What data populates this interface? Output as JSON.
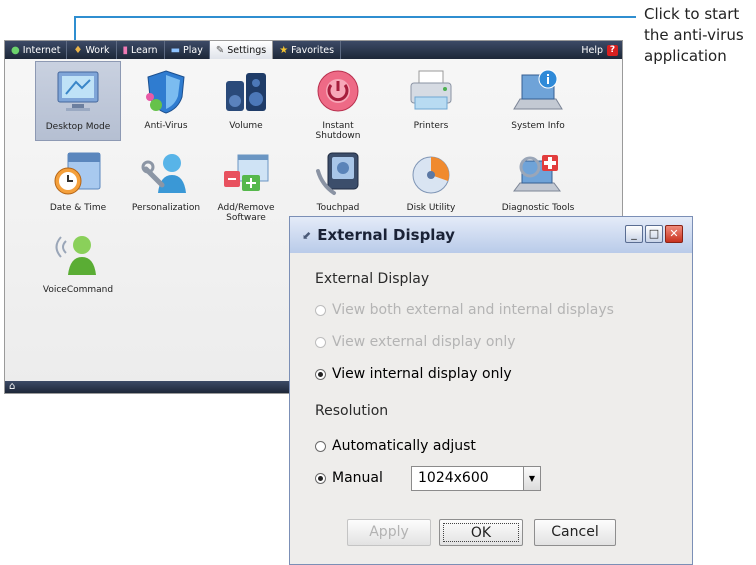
{
  "callout": {
    "lines": [
      "Click to start",
      "the anti-virus",
      "application"
    ],
    "color": "#2f8ed0"
  },
  "tabs": [
    {
      "label": "Internet",
      "icon": "globe-icon"
    },
    {
      "label": "Work",
      "icon": "work-icon"
    },
    {
      "label": "Learn",
      "icon": "learn-icon"
    },
    {
      "label": "Play",
      "icon": "play-icon"
    },
    {
      "label": "Settings",
      "icon": "wrench-icon",
      "active": true
    },
    {
      "label": "Favorites",
      "icon": "star-icon"
    }
  ],
  "help_label": "Help",
  "apps": [
    {
      "label": "Desktop Mode",
      "icon": "desktop-mode-icon",
      "selected": true
    },
    {
      "label": "Anti-Virus",
      "icon": "anti-virus-icon"
    },
    {
      "label": "Volume",
      "icon": "volume-icon"
    },
    {
      "label": "Instant\nShutdown",
      "icon": "shutdown-icon"
    },
    {
      "label": "Printers",
      "icon": "printer-icon"
    },
    {
      "label": "System Info",
      "icon": "system-info-icon"
    },
    {
      "label": "Date & Time",
      "icon": "calendar-clock-icon"
    },
    {
      "label": "Personalization",
      "icon": "personalization-icon"
    },
    {
      "label": "Add/Remove\nSoftware",
      "icon": "add-remove-software-icon"
    },
    {
      "label": "Touchpad",
      "icon": "touchpad-icon"
    },
    {
      "label": "Disk Utility",
      "icon": "disk-utility-icon"
    },
    {
      "label": "Diagnostic Tools",
      "icon": "diagnostic-tools-icon"
    },
    {
      "label": "VoiceCommand",
      "icon": "voice-command-icon"
    }
  ],
  "dialog": {
    "title": "External Display",
    "section_display": "External Display",
    "options_display": [
      {
        "label": "View both external and internal displays",
        "checked": false,
        "disabled": true
      },
      {
        "label": "View external display only",
        "checked": false,
        "disabled": true
      },
      {
        "label": "View internal display only",
        "checked": true,
        "disabled": false
      }
    ],
    "section_resolution": "Resolution",
    "options_resolution": [
      {
        "label": "Automatically adjust",
        "checked": false
      },
      {
        "label": "Manual",
        "checked": true
      }
    ],
    "resolution_value": "1024x600",
    "buttons": {
      "apply": "Apply",
      "ok": "OK",
      "cancel": "Cancel"
    }
  }
}
